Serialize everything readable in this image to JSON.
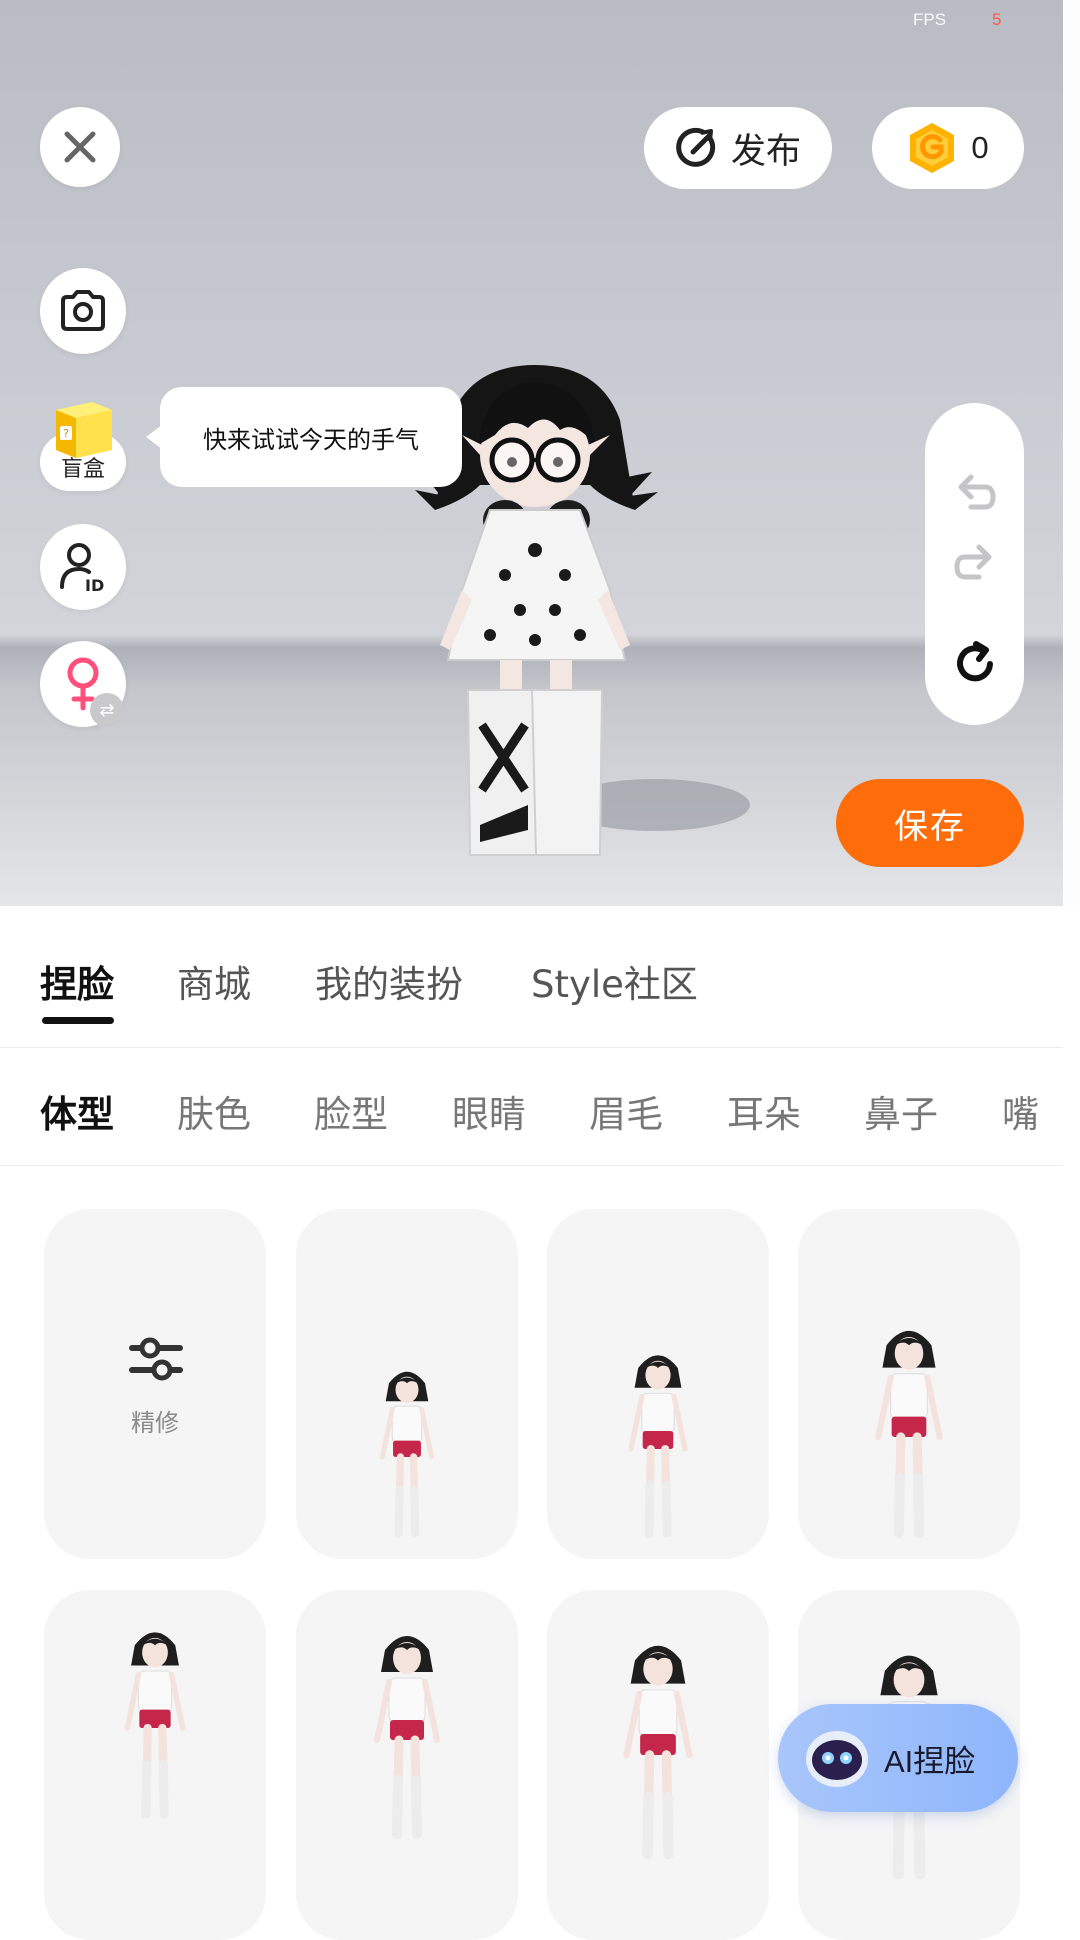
{
  "status": {
    "fps_label": "FPS",
    "fps_value": "5"
  },
  "header": {
    "publish_label": "发布",
    "coin_count": "0"
  },
  "side_tools": {
    "blind_box_label": "盲盒",
    "tooltip": "快来试试今天的手气"
  },
  "actions": {
    "save_label": "保存"
  },
  "main_tabs": [
    {
      "label": "捏脸",
      "active": true
    },
    {
      "label": "商城"
    },
    {
      "label": "我的装扮"
    },
    {
      "label": "Style社区"
    }
  ],
  "sub_tabs": [
    {
      "label": "体型",
      "active": true
    },
    {
      "label": "肤色"
    },
    {
      "label": "脸型"
    },
    {
      "label": "眼睛"
    },
    {
      "label": "眉毛"
    },
    {
      "label": "耳朵"
    },
    {
      "label": "鼻子"
    },
    {
      "label": "嘴"
    }
  ],
  "grid": {
    "fine_tune_label": "精修"
  },
  "ai_button": {
    "label": "AI捏脸"
  },
  "colors": {
    "accent": "#ff6d0a",
    "coin": "#ffb300",
    "female": "#ff4f7b",
    "ai_gradient": "#9bbdfb"
  }
}
